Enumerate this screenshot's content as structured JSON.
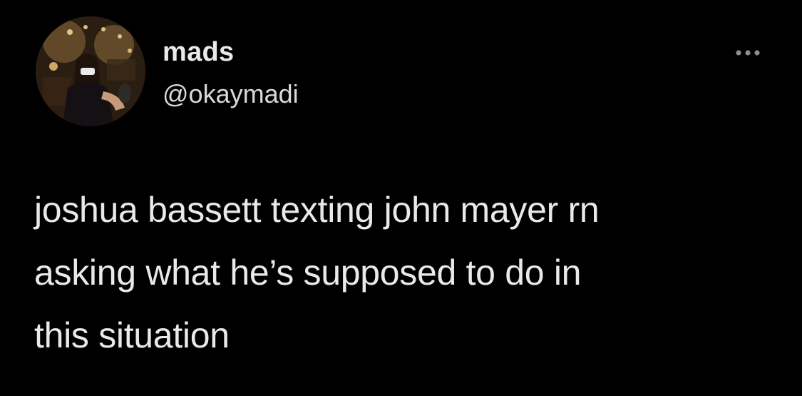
{
  "colors": {
    "background": "#000000",
    "text_primary": "#e7e9ea",
    "text_secondary": "#d6d9db",
    "more_icon": "#8b8f93"
  },
  "author": {
    "display_name": "mads",
    "handle": "@okaymadi",
    "avatar_icon": "profile-photo"
  },
  "tweet": {
    "text": "joshua bassett texting john mayer rn\nasking what he’s supposed to do in\nthis situation"
  },
  "actions": {
    "more_icon": "more-horizontal-icon"
  }
}
